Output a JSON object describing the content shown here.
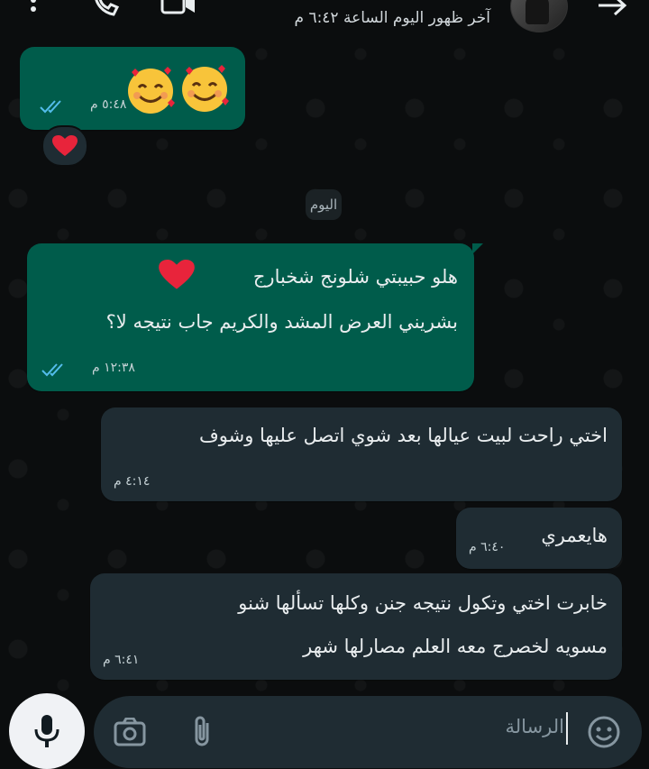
{
  "header": {
    "last_seen": "آخر ظهور اليوم الساعة ٦:٤٢ م",
    "icons": [
      "more-options-icon",
      "voice-call-icon",
      "video-call-icon",
      "back-arrow-icon"
    ]
  },
  "messages": [
    {
      "type": "out",
      "text": "",
      "emojis": [
        "smiling-face-with-hearts",
        "smiling-face-with-hearts"
      ],
      "time": "٥:٤٨ م",
      "status": "read",
      "reaction": "red-heart"
    },
    {
      "type": "out",
      "lines": [
        "هلو حبيبتي شلونج شخبارج",
        "بشريني العرض المشد والكريم جاب نتيجه لا؟"
      ],
      "emoji": "red-heart",
      "time": "١٢:٣٨ م",
      "status": "read"
    },
    {
      "type": "in",
      "lines": [
        "اختي راحت لبيت عيالها بعد شوي اتصل عليها وشوف"
      ],
      "time": "٤:١٤ م"
    },
    {
      "type": "in",
      "lines": [
        "هايعمري"
      ],
      "time": "٦:٤٠ م"
    },
    {
      "type": "in",
      "lines": [
        "خابرت اختي وتكول نتيجه جنن وكلها تسألها شنو",
        "مسويه لخصرج معه العلم مصارلها شهر"
      ],
      "time": "٦:٤١ م"
    }
  ],
  "date_separator": "اليوم",
  "input": {
    "placeholder": "الرسالة"
  },
  "colors": {
    "outgoing_bubble": "#005c4b",
    "incoming_bubble": "#1f2c33",
    "background": "#0b0d0e",
    "read_ticks": "#53bdeb"
  }
}
